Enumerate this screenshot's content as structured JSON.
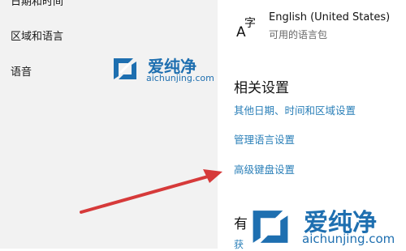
{
  "sidebar": {
    "items": [
      {
        "label": "日期和时间"
      },
      {
        "label": "区域和语言"
      },
      {
        "label": "语音"
      }
    ]
  },
  "language": {
    "name": "English (United States)",
    "status": "可用的语言包",
    "icon": "language-icon",
    "icon_glyph_a": "A",
    "icon_glyph_zi": "字"
  },
  "related": {
    "title": "相关设置",
    "links": [
      {
        "label": "其他日期、时间和区域设置"
      },
      {
        "label": "管理语言设置"
      },
      {
        "label": "高级键盘设置"
      }
    ]
  },
  "partial": {
    "heading": "有",
    "link": "获"
  },
  "watermark": {
    "brand": "爱纯净",
    "url": "aichunjing.com"
  },
  "colors": {
    "link": "#2a7fb8",
    "arrow": "#d63a3a",
    "watermark": "#1e6fb0",
    "sidebar_bg": "#f2f2f2"
  }
}
